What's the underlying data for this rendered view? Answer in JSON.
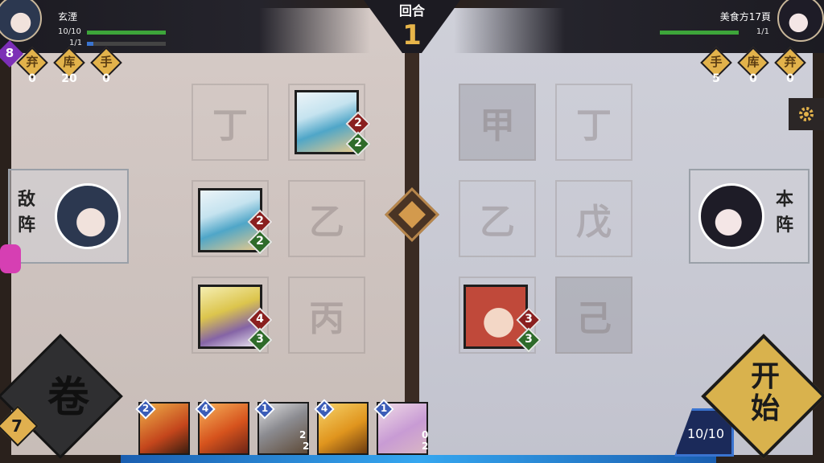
{
  "round": {
    "label": "回合",
    "number": "1"
  },
  "enemy": {
    "name": "玄湮",
    "hp": "10/10",
    "hp_ratio": 1.0,
    "mana": "1/1",
    "mana_ratio": 1.0,
    "level": "8",
    "counters": [
      {
        "char": "弃",
        "value": "0"
      },
      {
        "char": "库",
        "value": "20"
      },
      {
        "char": "手",
        "value": "0"
      }
    ],
    "tag_top": "敌",
    "tag_bottom": "阵"
  },
  "player": {
    "name": "美食方17頁",
    "mana": "1/1",
    "hp_ratio": 1.0,
    "counters": [
      {
        "char": "手",
        "value": "5"
      },
      {
        "char": "库",
        "value": "0"
      },
      {
        "char": "弃",
        "value": "0"
      }
    ],
    "tag_top": "本",
    "tag_bottom": "阵"
  },
  "left_grid": {
    "slots": [
      "丁",
      "乙",
      "丙"
    ]
  },
  "right_grid": {
    "slots": [
      "甲",
      "丁",
      "乙",
      "戊",
      "己"
    ]
  },
  "board_units": [
    {
      "name": "bird-unit-top",
      "atk": "2",
      "hp": "2"
    },
    {
      "name": "bird-unit-mid",
      "atk": "2",
      "hp": "2"
    },
    {
      "name": "knight-unit",
      "atk": "4",
      "hp": "3"
    },
    {
      "name": "girl-unit",
      "atk": "3",
      "hp": "3"
    }
  ],
  "deck": {
    "char": "卷",
    "count": "7"
  },
  "start_button": {
    "label_top": "开",
    "label_bottom": "始"
  },
  "mana_display": "10/10",
  "hand": [
    {
      "cost": "2",
      "atk": "",
      "hp": ""
    },
    {
      "cost": "4",
      "atk": "",
      "hp": ""
    },
    {
      "cost": "1",
      "atk": "2",
      "hp": "2"
    },
    {
      "cost": "4",
      "atk": "",
      "hp": ""
    },
    {
      "cost": "1",
      "atk": "0",
      "hp": "2"
    }
  ],
  "colors": {
    "accent_gold": "#e2b24b",
    "hp_green": "#3da53a",
    "mana_blue": "#3a74d0",
    "enemy_level": "#7c2fb6"
  }
}
